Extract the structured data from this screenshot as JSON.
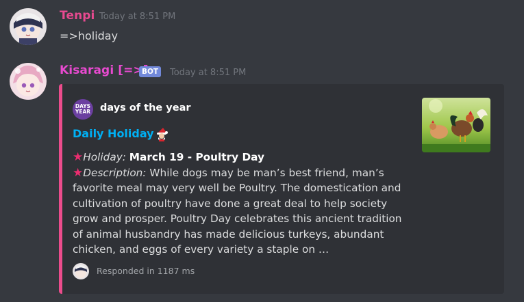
{
  "colors": {
    "background": "#36393f",
    "embed_background": "#2f3136",
    "embed_accent": "#ec4c8c",
    "tenpi_name": "#e84a90",
    "kisaragi_name": "#e84ad0",
    "title_link": "#00b0f4",
    "bot_tag": "#7289da",
    "star": "#ec2d6f"
  },
  "messages": [
    {
      "username": "Tenpi",
      "timestamp": "Today at 8:51 PM",
      "content": "=>holiday",
      "avatar_icon": "anime-girl-avatar-icon"
    },
    {
      "username": "Kisaragi [=>]",
      "bot_tag": "BOT",
      "timestamp": "Today at 8:51 PM",
      "avatar_icon": "anime-girl-pink-hair-avatar-icon",
      "embed": {
        "author_icon_text_line1": "DAYS",
        "author_icon_text_line2": "YEAR",
        "author_name": "days of the year",
        "title": "Daily Holiday",
        "title_emoji": "santa-emoji-icon",
        "holiday_label": "Holiday:",
        "holiday_value": "March 19 - Poultry Day",
        "description_label": "Description:",
        "description_text": "While dogs may be man’s best friend, man’s favorite meal may very well be Poultry.  The domestication and cultivation of poultry have done a great deal to help society grow and prosper. Poultry Day celebrates this ancient tradition of animal husbandry has made delicious turkeys, abundant chicken, and eggs of every variety a staple on …",
        "thumbnail": "poultry-chickens-thumbnail",
        "footer_text": "Responded in 1187 ms",
        "footer_icon": "bot-avatar-icon"
      }
    }
  ]
}
